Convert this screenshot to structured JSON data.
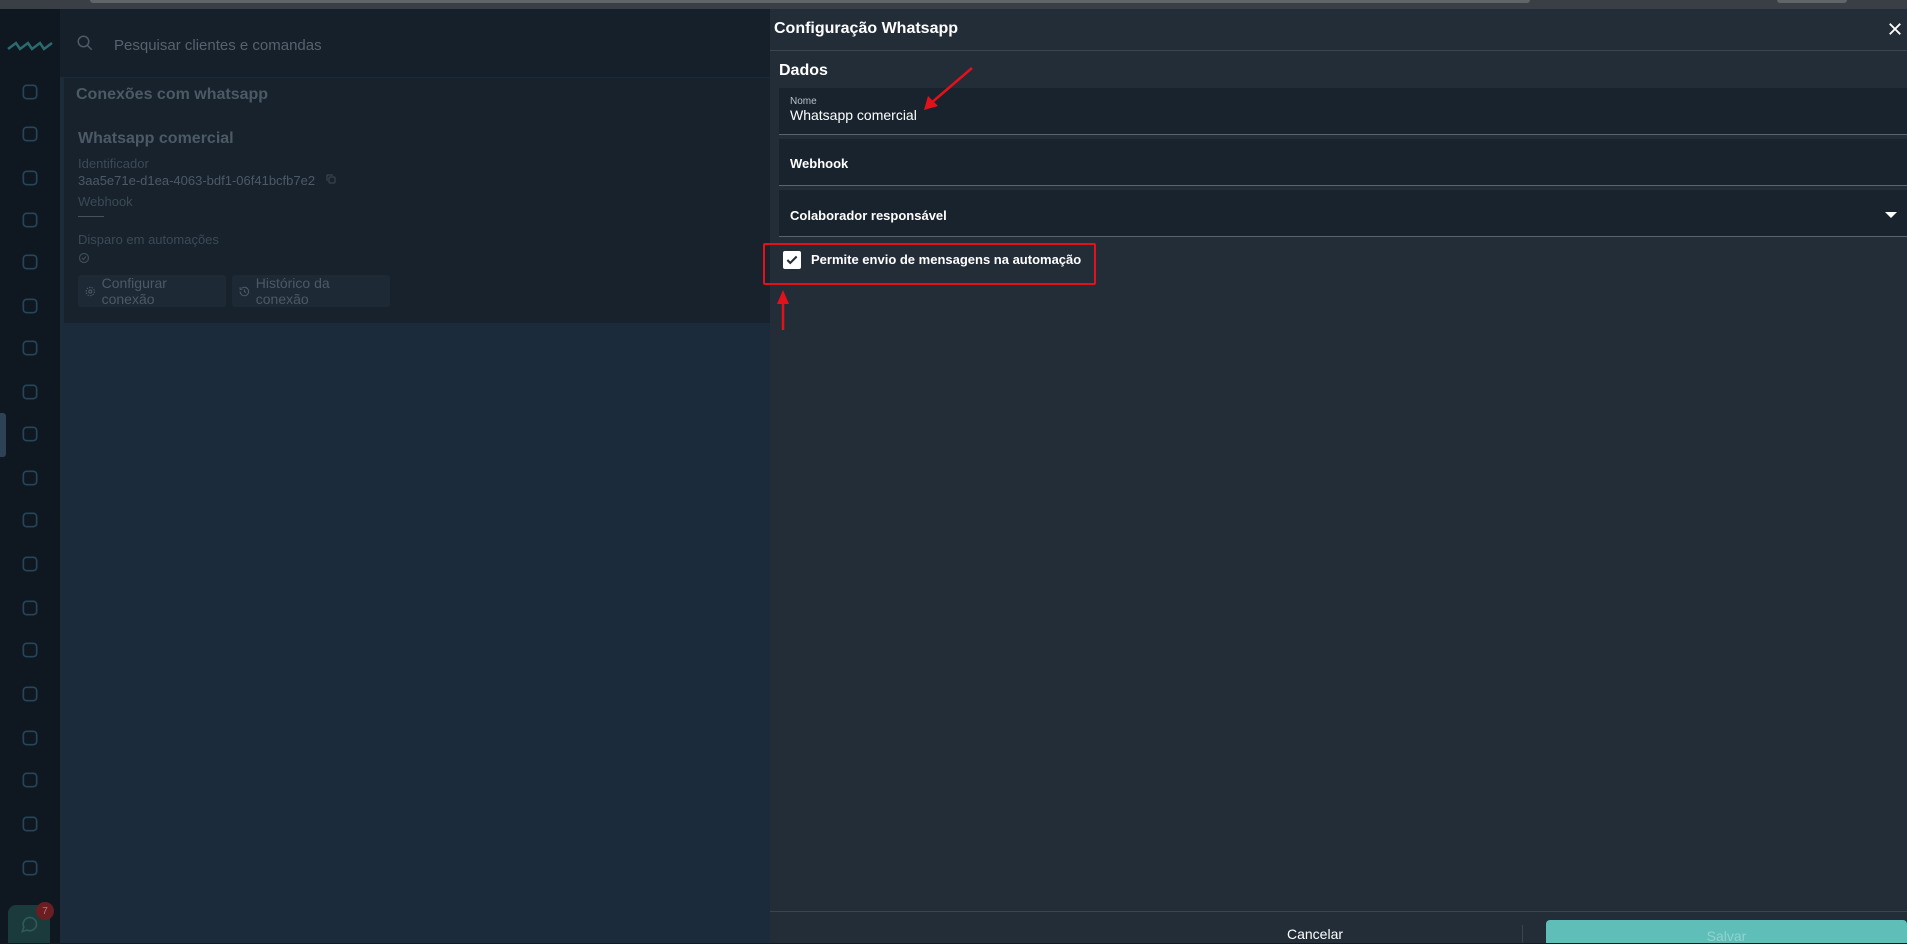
{
  "header": {
    "search_placeholder": "Pesquisar clientes e comandas"
  },
  "sidebar": {
    "items": [
      "home-icon",
      "calendar-icon",
      "lightbulb-icon",
      "chart-doc-icon",
      "target-icon",
      "users-icon",
      "bar-chart-icon",
      "dollar-icon",
      "settings-cycle-icon",
      "coin-icon",
      "document-icon",
      "box-icon",
      "cubes-icon",
      "gear-icon",
      "store-icon",
      "wrench-icon",
      "server-icon",
      "file-plus-icon",
      "flag-icon"
    ],
    "chat_badge": "7"
  },
  "page": {
    "title": "Conexões com whatsapp",
    "connection": {
      "name": "Whatsapp comercial",
      "identifier_label": "Identificador",
      "identifier_value": "3aa5e71e-d1ea-4063-bdf1-06f41bcfb7e2",
      "webhook_label": "Webhook",
      "webhook_value": "——",
      "automation_label": "Disparo em automações",
      "configure_button": "Configurar conexão",
      "history_button": "Histórico da conexão"
    }
  },
  "drawer": {
    "title": "Configuração Whatsapp",
    "section_title": "Dados",
    "name_field": {
      "label": "Nome",
      "value": "Whatsapp comercial"
    },
    "webhook_field": {
      "label": "Webhook"
    },
    "collaborator_field": {
      "label": "Colaborador responsável"
    },
    "automation_checkbox": {
      "label": "Permite envio de mensagens na automação",
      "checked": true
    },
    "cancel_button": "Cancelar",
    "save_button": "Salvar"
  },
  "colors": {
    "accent": "#5fbeb8",
    "annotation": "#e3111b",
    "drawer_bg": "#232d38"
  }
}
